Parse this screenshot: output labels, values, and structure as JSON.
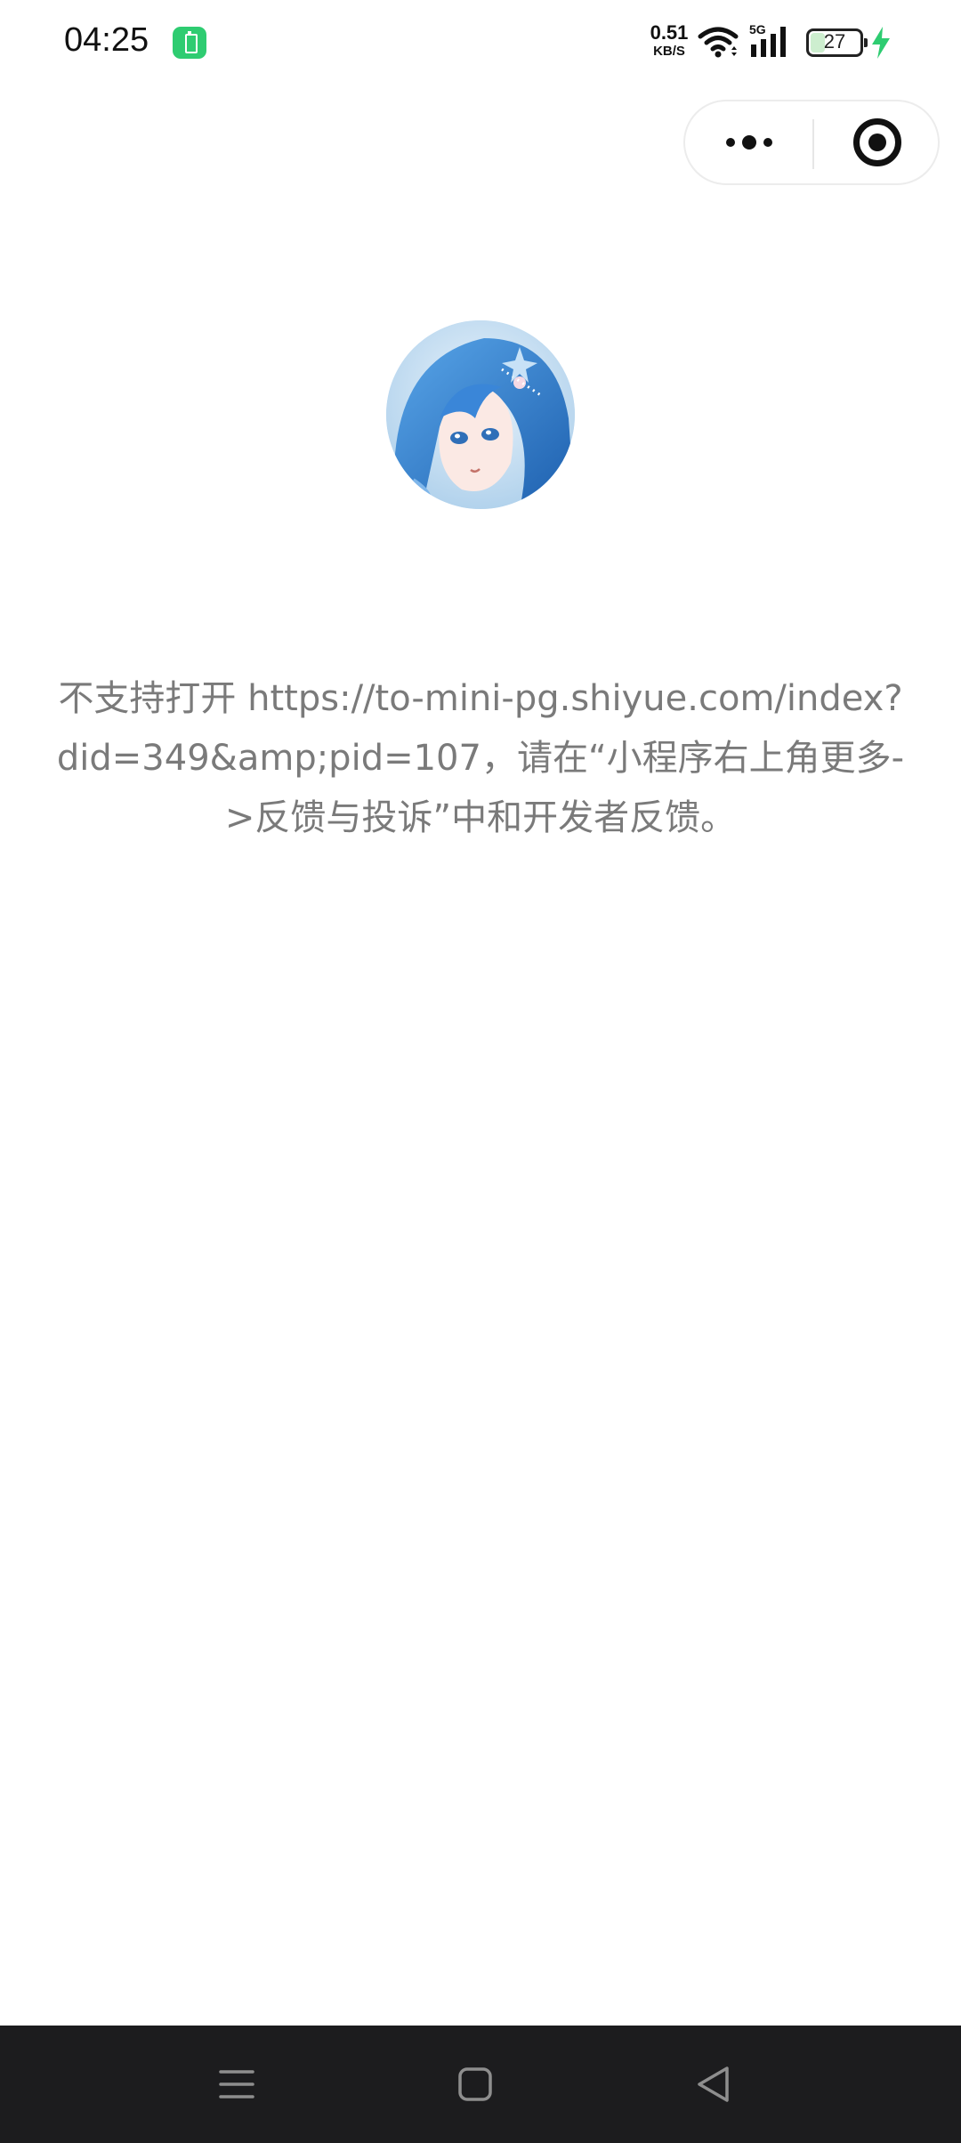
{
  "status_bar": {
    "time": "04:25",
    "net_speed_value": "0.51",
    "net_speed_unit": "KB/S",
    "network_type": "5G",
    "battery_percent": "27",
    "battery_level": 0.27,
    "charging": true
  },
  "capsule": {
    "more_icon": "more-dots-icon",
    "close_icon": "close-target-icon"
  },
  "avatar": {
    "icon": "anime-avatar-image"
  },
  "message": {
    "text": "不支持打开 https://to-mini-pg.shiyue.com/index?did=349&amp;pid=107，请在“小程序右上角更多->反馈与投诉”中和开发者反馈。"
  },
  "nav_bar": {
    "menu_icon": "menu-lines-icon",
    "home_icon": "home-square-icon",
    "back_icon": "back-triangle-icon"
  },
  "colors": {
    "message_text": "#7a7a7a",
    "nav_background": "#1c1c1e",
    "charge_green": "#2ecc71"
  }
}
